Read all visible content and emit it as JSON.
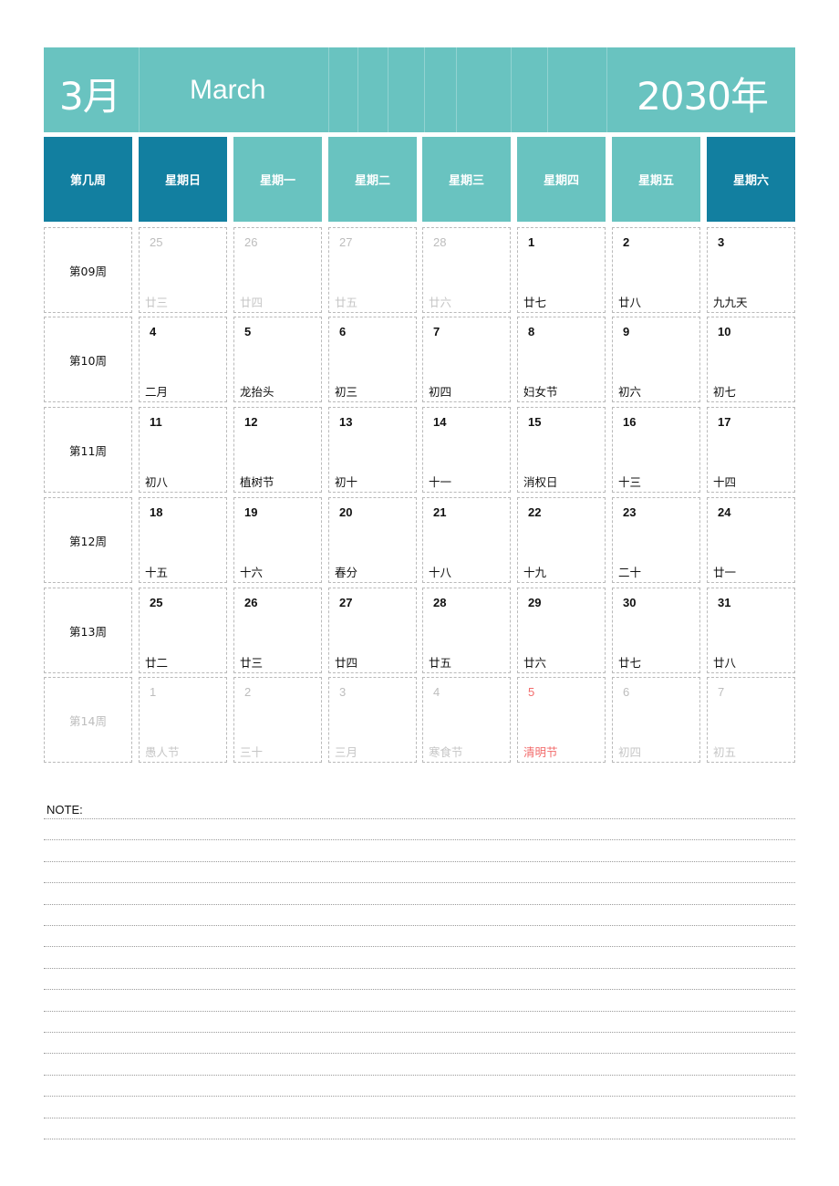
{
  "header": {
    "month_number": "3月",
    "month_name": "March",
    "year": "2030年",
    "colors": {
      "banner": "#69c3c0",
      "weekend_header": "#127fa0",
      "weekday_header": "#69c3c0",
      "holiday_text": "#f26b6b"
    }
  },
  "columns": [
    "第几周",
    "星期日",
    "星期一",
    "星期二",
    "星期三",
    "星期四",
    "星期五",
    "星期六"
  ],
  "weeks": [
    {
      "label": "第09周",
      "faded": false,
      "days": [
        {
          "day": "25",
          "lunar": "廿三",
          "state": "faded"
        },
        {
          "day": "26",
          "lunar": "廿四",
          "state": "faded"
        },
        {
          "day": "27",
          "lunar": "廿五",
          "state": "faded"
        },
        {
          "day": "28",
          "lunar": "廿六",
          "state": "faded"
        },
        {
          "day": "1",
          "lunar": "廿七",
          "state": "normal"
        },
        {
          "day": "2",
          "lunar": "廿八",
          "state": "normal"
        },
        {
          "day": "3",
          "lunar": "九九天",
          "state": "normal"
        }
      ]
    },
    {
      "label": "第10周",
      "faded": false,
      "days": [
        {
          "day": "4",
          "lunar": "二月",
          "state": "normal"
        },
        {
          "day": "5",
          "lunar": "龙抬头",
          "state": "normal"
        },
        {
          "day": "6",
          "lunar": "初三",
          "state": "normal"
        },
        {
          "day": "7",
          "lunar": "初四",
          "state": "normal"
        },
        {
          "day": "8",
          "lunar": "妇女节",
          "state": "normal"
        },
        {
          "day": "9",
          "lunar": "初六",
          "state": "normal"
        },
        {
          "day": "10",
          "lunar": "初七",
          "state": "normal"
        }
      ]
    },
    {
      "label": "第11周",
      "faded": false,
      "days": [
        {
          "day": "11",
          "lunar": "初八",
          "state": "normal"
        },
        {
          "day": "12",
          "lunar": "植树节",
          "state": "normal"
        },
        {
          "day": "13",
          "lunar": "初十",
          "state": "normal"
        },
        {
          "day": "14",
          "lunar": "十一",
          "state": "normal"
        },
        {
          "day": "15",
          "lunar": "消权日",
          "state": "normal"
        },
        {
          "day": "16",
          "lunar": "十三",
          "state": "normal"
        },
        {
          "day": "17",
          "lunar": "十四",
          "state": "normal"
        }
      ]
    },
    {
      "label": "第12周",
      "faded": false,
      "days": [
        {
          "day": "18",
          "lunar": "十五",
          "state": "normal"
        },
        {
          "day": "19",
          "lunar": "十六",
          "state": "normal"
        },
        {
          "day": "20",
          "lunar": "春分",
          "state": "normal"
        },
        {
          "day": "21",
          "lunar": "十八",
          "state": "normal"
        },
        {
          "day": "22",
          "lunar": "十九",
          "state": "normal"
        },
        {
          "day": "23",
          "lunar": "二十",
          "state": "normal"
        },
        {
          "day": "24",
          "lunar": "廿一",
          "state": "normal"
        }
      ]
    },
    {
      "label": "第13周",
      "faded": false,
      "days": [
        {
          "day": "25",
          "lunar": "廿二",
          "state": "normal"
        },
        {
          "day": "26",
          "lunar": "廿三",
          "state": "normal"
        },
        {
          "day": "27",
          "lunar": "廿四",
          "state": "normal"
        },
        {
          "day": "28",
          "lunar": "廿五",
          "state": "normal"
        },
        {
          "day": "29",
          "lunar": "廿六",
          "state": "normal"
        },
        {
          "day": "30",
          "lunar": "廿七",
          "state": "normal"
        },
        {
          "day": "31",
          "lunar": "廿八",
          "state": "normal"
        }
      ]
    },
    {
      "label": "第14周",
      "faded": true,
      "days": [
        {
          "day": "1",
          "lunar": "愚人节",
          "state": "faded"
        },
        {
          "day": "2",
          "lunar": "三十",
          "state": "faded"
        },
        {
          "day": "3",
          "lunar": "三月",
          "state": "faded"
        },
        {
          "day": "4",
          "lunar": "寒食节",
          "state": "faded"
        },
        {
          "day": "5",
          "lunar": "清明节",
          "state": "holiday"
        },
        {
          "day": "6",
          "lunar": "初四",
          "state": "faded"
        },
        {
          "day": "7",
          "lunar": "初五",
          "state": "faded"
        }
      ]
    }
  ],
  "notes": {
    "label": "NOTE:",
    "line_count": 16
  }
}
